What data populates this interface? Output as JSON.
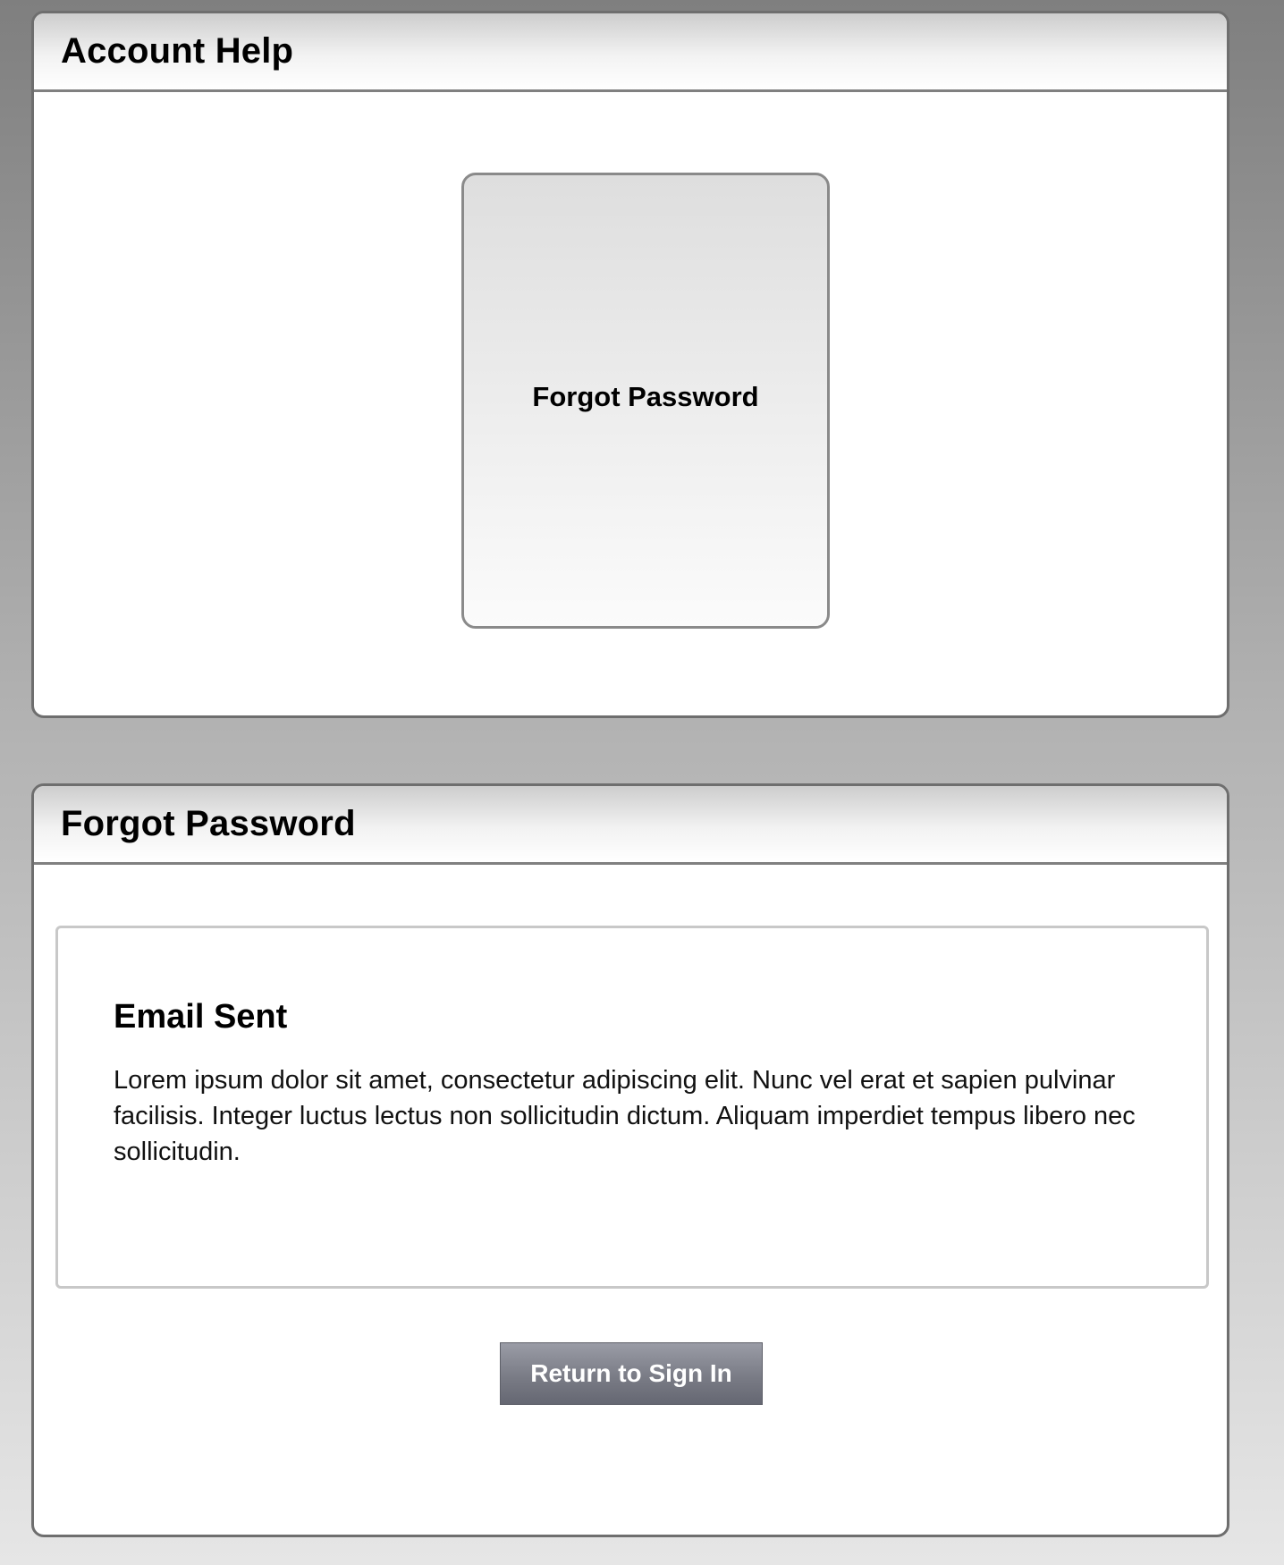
{
  "account_help": {
    "title": "Account Help",
    "tile_label": "Forgot Password"
  },
  "forgot_password": {
    "title": "Forgot Password",
    "message": {
      "heading": "Email Sent",
      "body": "Lorem ipsum dolor sit amet, consectetur adipiscing elit. Nunc vel erat et sapien pulvinar facilisis. Integer luctus lectus non sollicitudin dictum. Aliquam imperdiet tempus libero nec sollicitudin."
    },
    "return_button_label": "Return to Sign In"
  },
  "colors": {
    "panel_border": "#6e6e6e",
    "button_gradient_top": "#9a9ca6",
    "button_gradient_bottom": "#656772"
  }
}
